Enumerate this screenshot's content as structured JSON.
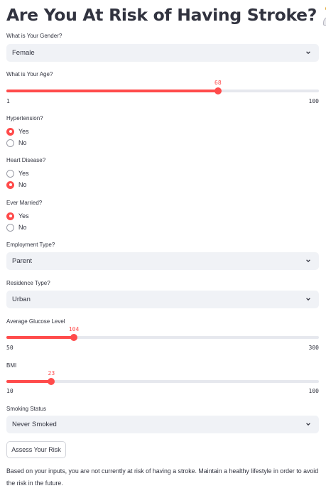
{
  "page": {
    "title": "Are You At Risk of Having Stroke?",
    "title_icon": "health-worker-emoji"
  },
  "colors": {
    "accent": "#ff4b4b",
    "input_bg": "#f0f2f6",
    "text": "#31333f",
    "track": "#e6e8ee"
  },
  "gender": {
    "label": "What is Your Gender?",
    "value": "Female"
  },
  "age": {
    "label": "What is Your Age?",
    "value": "68",
    "min": "1",
    "max": "100",
    "fraction": 0.677
  },
  "hypertension": {
    "label": "Hypertension?",
    "options": [
      "Yes",
      "No"
    ],
    "selected": "Yes"
  },
  "heart_disease": {
    "label": "Heart Disease?",
    "options": [
      "Yes",
      "No"
    ],
    "selected": "No"
  },
  "ever_married": {
    "label": "Ever Married?",
    "options": [
      "Yes",
      "No"
    ],
    "selected": "Yes"
  },
  "employment": {
    "label": "Employment Type?",
    "value": "Parent"
  },
  "residence": {
    "label": "Residence Type?",
    "value": "Urban"
  },
  "glucose": {
    "label": "Average Glucose Level",
    "value": "104",
    "min": "50",
    "max": "300",
    "fraction": 0.216
  },
  "bmi": {
    "label": "BMI",
    "value": "23",
    "min": "10",
    "max": "100",
    "fraction": 0.144
  },
  "smoking": {
    "label": "Smoking Status",
    "value": "Never Smoked"
  },
  "actions": {
    "assess_label": "Assess Your Risk"
  },
  "result": {
    "text": "Based on your inputs, you are not currently at risk of having a stroke. Maintain a healthy lifestyle in order to avoid the risk in the future."
  }
}
